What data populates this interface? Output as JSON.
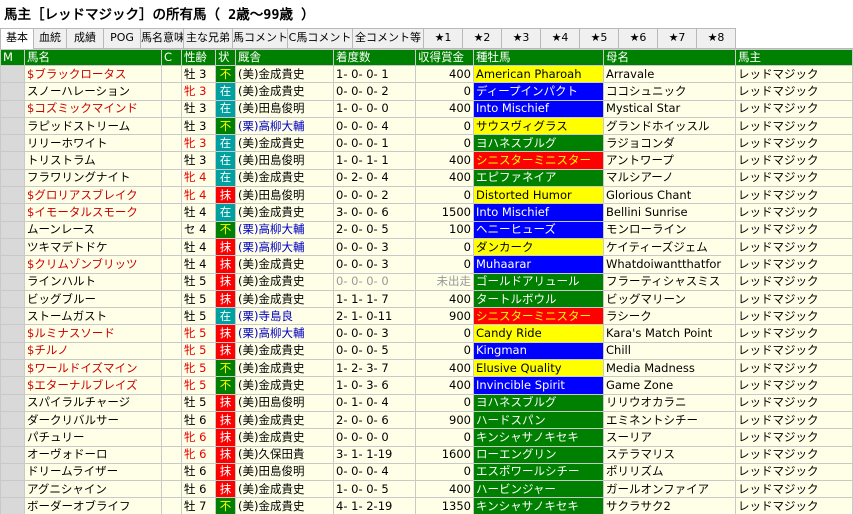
{
  "title": "馬主［レッドマジック］の所有馬（ 2歳～99歳 ）",
  "tabs": [
    "基本",
    "血統",
    "成績",
    "POG",
    "馬名意味",
    "主な兄弟",
    "馬コメント",
    "C馬コメント",
    "全コメント等",
    "★1",
    "★2",
    "★3",
    "★4",
    "★5",
    "★6",
    "★7",
    "★8"
  ],
  "columns": [
    "M",
    "馬名",
    "C",
    "性齢",
    "状",
    "厩舎",
    "着度数",
    "収得賞金",
    "種牡馬",
    "母名",
    "馬主"
  ],
  "colors": {
    "header_bg": "#008000",
    "red": "#ff0000",
    "green": "#008000",
    "blue": "#0000ff",
    "yellow": "#ffff00",
    "lightblue": "#00bfff"
  },
  "rows": [
    {
      "name": "$ブラックロータス",
      "sex": "牡",
      "age": "3",
      "status": "不",
      "stable": "(美)金成貴史",
      "record": "1- 0- 0- 1",
      "prize": "400",
      "sire": "American Pharoah",
      "sire_c": "yellow",
      "dam": "Arravale",
      "owner": "レッドマジック"
    },
    {
      "name": "スノーハレーション",
      "sex": "牝",
      "age": "3",
      "status": "在",
      "stable": "(美)金成貴史",
      "record": "0- 0- 0- 2",
      "prize": "0",
      "sire": "ディープインパクト",
      "sire_c": "blue",
      "dam": "ココシュニック",
      "owner": "レッドマジック"
    },
    {
      "name": "$コズミックマインド",
      "sex": "牡",
      "age": "3",
      "status": "在",
      "stable": "(美)田島俊明",
      "record": "1- 0- 0- 0",
      "prize": "400",
      "sire": "Into Mischief",
      "sire_c": "blue",
      "dam": "Mystical Star",
      "owner": "レッドマジック"
    },
    {
      "name": "ラピッドストリーム",
      "sex": "牡",
      "age": "3",
      "status": "不",
      "stable": "(栗)高柳大輔",
      "record": "0- 0- 0- 4",
      "prize": "0",
      "sire": "サウスヴィグラス",
      "sire_c": "yellow",
      "dam": "グランドホイッスル",
      "owner": "レッドマジック"
    },
    {
      "name": "リリーホワイト",
      "sex": "牝",
      "age": "3",
      "status": "在",
      "stable": "(美)金成貴史",
      "record": "0- 0- 0- 1",
      "prize": "0",
      "sire": "ヨハネスブルグ",
      "sire_c": "green",
      "dam": "ラジョコンダ",
      "owner": "レッドマジック"
    },
    {
      "name": "トリストラム",
      "sex": "牡",
      "age": "3",
      "status": "在",
      "stable": "(美)田島俊明",
      "record": "1- 0- 1- 1",
      "prize": "400",
      "sire": "シニスターミニスター",
      "sire_c": "red",
      "dam": "アントワープ",
      "owner": "レッドマジック"
    },
    {
      "name": "フラワリングナイト",
      "sex": "牝",
      "age": "4",
      "status": "在",
      "stable": "(美)金成貴史",
      "record": "0- 2- 0- 4",
      "prize": "400",
      "sire": "エピファネイア",
      "sire_c": "green",
      "dam": "マルシアーノ",
      "owner": "レッドマジック"
    },
    {
      "name": "$グロリアスブレイク",
      "sex": "牝",
      "age": "4",
      "status": "抹",
      "stable": "(美)田島俊明",
      "record": "0- 0- 0- 2",
      "prize": "0",
      "sire": "Distorted Humor",
      "sire_c": "yellow",
      "dam": "Glorious Chant",
      "owner": "レッドマジック"
    },
    {
      "name": "$イモータルスモーク",
      "sex": "牡",
      "age": "4",
      "status": "在",
      "stable": "(美)金成貴史",
      "record": "3- 0- 0- 6",
      "prize": "1500",
      "sire": "Into Mischief",
      "sire_c": "blue",
      "dam": "Bellini Sunrise",
      "owner": "レッドマジック"
    },
    {
      "name": "ムーンレース",
      "sex": "セ",
      "age": "4",
      "status": "不",
      "stable": "(栗)高柳大輔",
      "record": "2- 0- 0- 5",
      "prize": "100",
      "sire": "ヘニーヒューズ",
      "sire_c": "blue",
      "dam": "モンローライン",
      "owner": "レッドマジック"
    },
    {
      "name": "ツキマデトドケ",
      "sex": "牡",
      "age": "4",
      "status": "抹",
      "stable": "(栗)高柳大輔",
      "record": "0- 0- 0- 3",
      "prize": "0",
      "sire": "ダンカーク",
      "sire_c": "yellow",
      "dam": "ケイティーズジェム",
      "owner": "レッドマジック"
    },
    {
      "name": "$クリムゾンブリッツ",
      "sex": "牡",
      "age": "4",
      "status": "抹",
      "stable": "(美)金成貴史",
      "record": "0- 0- 0- 3",
      "prize": "0",
      "sire": "Muhaarar",
      "sire_c": "blue",
      "dam": "Whatdoiwantthatfor",
      "owner": "レッドマジック"
    },
    {
      "name": "ラインハルト",
      "sex": "牡",
      "age": "5",
      "status": "抹",
      "stable": "(美)金成貴史",
      "record": "0- 0- 0- 0",
      "prize": "未出走",
      "sire": "ゴールドアリュール",
      "sire_c": "green",
      "dam": "フラーティシャスミス",
      "owner": "レッドマジック"
    },
    {
      "name": "ビッグブルー",
      "sex": "牡",
      "age": "5",
      "status": "抹",
      "stable": "(美)金成貴史",
      "record": "1- 1- 1- 7",
      "prize": "400",
      "sire": "タートルボウル",
      "sire_c": "green",
      "dam": "ビッグマリーン",
      "owner": "レッドマジック"
    },
    {
      "name": "ストームガスト",
      "sex": "牡",
      "age": "5",
      "status": "在",
      "stable": "(栗)寺島良",
      "record": "2- 1- 0-11",
      "prize": "900",
      "sire": "シニスターミニスター",
      "sire_c": "red",
      "dam": "ラシーク",
      "owner": "レッドマジック"
    },
    {
      "name": "$ルミナスソード",
      "sex": "牝",
      "age": "5",
      "status": "抹",
      "stable": "(栗)高柳大輔",
      "record": "0- 0- 0- 3",
      "prize": "0",
      "sire": "Candy Ride",
      "sire_c": "yellow",
      "dam": "Kara's Match Point",
      "owner": "レッドマジック"
    },
    {
      "name": "$チルノ",
      "sex": "牝",
      "age": "5",
      "status": "抹",
      "stable": "(美)金成貴史",
      "record": "0- 0- 0- 5",
      "prize": "0",
      "sire": "Kingman",
      "sire_c": "blue",
      "dam": "Chill",
      "owner": "レッドマジック"
    },
    {
      "name": "$ワールドイズマイン",
      "sex": "牝",
      "age": "5",
      "status": "不",
      "stable": "(美)金成貴史",
      "record": "1- 2- 3- 7",
      "prize": "400",
      "sire": "Elusive Quality",
      "sire_c": "yellow",
      "dam": "Media Madness",
      "owner": "レッドマジック"
    },
    {
      "name": "$エターナルブレイズ",
      "sex": "牝",
      "age": "5",
      "status": "不",
      "stable": "(美)金成貴史",
      "record": "1- 0- 3- 6",
      "prize": "400",
      "sire": "Invincible Spirit",
      "sire_c": "blue",
      "dam": "Game Zone",
      "owner": "レッドマジック"
    },
    {
      "name": "スパイラルチャージ",
      "sex": "牡",
      "age": "5",
      "status": "抹",
      "stable": "(美)田島俊明",
      "record": "0- 1- 0- 4",
      "prize": "0",
      "sire": "ヨハネスブルグ",
      "sire_c": "green",
      "dam": "リリウオカラニ",
      "owner": "レッドマジック"
    },
    {
      "name": "ダークリバルサー",
      "sex": "牡",
      "age": "6",
      "status": "抹",
      "stable": "(美)金成貴史",
      "record": "2- 0- 0- 6",
      "prize": "900",
      "sire": "ハードスパン",
      "sire_c": "green",
      "dam": "エミネントシチー",
      "owner": "レッドマジック"
    },
    {
      "name": "パチュリー",
      "sex": "牝",
      "age": "6",
      "status": "抹",
      "stable": "(美)金成貴史",
      "record": "0- 0- 0- 0",
      "prize": "0",
      "sire": "キンシャサノキセキ",
      "sire_c": "green",
      "dam": "スーリア",
      "owner": "レッドマジック"
    },
    {
      "name": "オーヴォドーロ",
      "sex": "牝",
      "age": "6",
      "status": "抹",
      "stable": "(美)久保田貴",
      "record": "3- 1- 1-19",
      "prize": "1600",
      "sire": "ローエングリン",
      "sire_c": "green",
      "dam": "ステラマリス",
      "owner": "レッドマジック"
    },
    {
      "name": "ドリームライザー",
      "sex": "牡",
      "age": "6",
      "status": "抹",
      "stable": "(美)田島俊明",
      "record": "0- 0- 0- 4",
      "prize": "0",
      "sire": "エスポワールシチー",
      "sire_c": "green",
      "dam": "ポリリズム",
      "owner": "レッドマジック"
    },
    {
      "name": "アグニシャイン",
      "sex": "牡",
      "age": "6",
      "status": "抹",
      "stable": "(美)金成貴史",
      "record": "1- 0- 0- 5",
      "prize": "400",
      "sire": "ハービンジャー",
      "sire_c": "green",
      "dam": "ガールオンファイア",
      "owner": "レッドマジック"
    },
    {
      "name": "ボーダーオブライフ",
      "sex": "牡",
      "age": "7",
      "status": "不",
      "stable": "(美)金成貴史",
      "record": "4- 1- 2-19",
      "prize": "1350",
      "sire": "キンシャサノキセキ",
      "sire_c": "green",
      "dam": "サクラサク2",
      "owner": "レッドマジック"
    }
  ]
}
